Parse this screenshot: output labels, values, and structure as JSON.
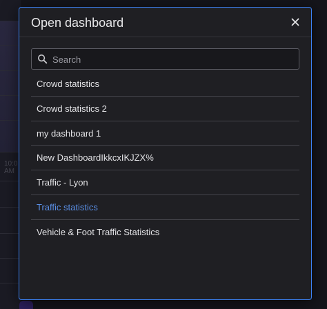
{
  "background": {
    "axis_label": "10:0\nAM"
  },
  "dialog": {
    "title": "Open dashboard",
    "close_icon": "close-icon",
    "search": {
      "placeholder": "Search",
      "value": "",
      "icon": "search-icon"
    },
    "items": [
      {
        "label": "Crowd statistics",
        "active": false
      },
      {
        "label": "Crowd statistics 2",
        "active": false
      },
      {
        "label": "my dashboard 1",
        "active": false
      },
      {
        "label": "New DashboardIkkcxIKJZX%",
        "active": false
      },
      {
        "label": "Traffic - Lyon",
        "active": false
      },
      {
        "label": "Traffic statistics",
        "active": true
      },
      {
        "label": "Vehicle & Foot Traffic Statistics",
        "active": false
      }
    ]
  },
  "colors": {
    "accent": "#3b82f6",
    "active_item": "#5a8fe6",
    "dialog_bg": "#1f1f23",
    "text": "#e3e3e6"
  }
}
